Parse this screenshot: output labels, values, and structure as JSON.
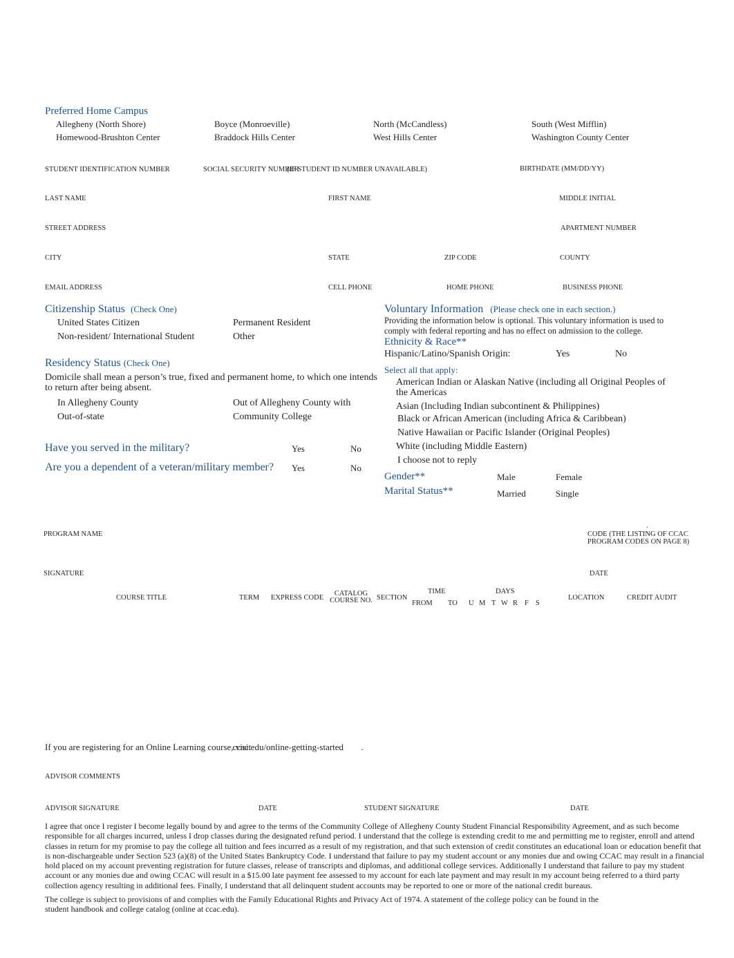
{
  "campus": {
    "title": "Preferred Home Campus",
    "options": [
      "Allegheny (North Shore)",
      "Boyce (Monroeville)",
      "North (McCandless)",
      "South (West Mifflin)",
      "Homewood-Brushton Center",
      "Braddock Hills Center",
      "West Hills Center",
      "Washington County Center"
    ]
  },
  "fields": {
    "student_id": "STUDENT IDENTIFICATION NUMBER",
    "ssn": "SOCIAL SECURITY NUMBER",
    "ssn_note": "(IF STUDENT ID NUMBER UNAVAILABLE)",
    "birthdate": "BIRTHDATE (MM/DD/YY)",
    "last_name": "LAST NAME",
    "first_name": "FIRST NAME",
    "middle_initial": "MIDDLE INITIAL",
    "street_address": "STREET ADDRESS",
    "apartment_number": "APARTMENT NUMBER",
    "city": "CITY",
    "state": "STATE",
    "zip_code": "ZIP CODE",
    "county": "COUNTY",
    "email_address": "EMAIL ADDRESS",
    "cell_phone": "CELL PHONE",
    "home_phone": "HOME PHONE",
    "business_phone": "BUSINESS PHONE"
  },
  "citizenship": {
    "title": "Citizenship Status",
    "note": "(Check One)",
    "options": [
      "United States Citizen",
      "Permanent Resident",
      "Non-resident/ International Student",
      "Other"
    ]
  },
  "residency": {
    "title": "Residency Status",
    "note": "(Check One)",
    "description": "Domicile shall mean a person’s true, fixed and permanent home, to which one intends to return after being absent.",
    "options": [
      "In Allegheny County",
      "Out of Allegheny County with",
      "Out-of-state",
      "Community College"
    ]
  },
  "military": {
    "served_question": "Have you served in the military?",
    "dependent_question": "Are you a dependent of a veteran/military member?",
    "yes": "Yes",
    "no": "No"
  },
  "voluntary": {
    "title": "Voluntary Information",
    "note": "(Please check one in each section.)",
    "description": "Providing the information below is optional. This voluntary information is used to comply with federal reporting and has no effect on admission to the college.",
    "ethnicity_title": "Ethnicity & Race**",
    "hispanic_label": "Hispanic/Latino/Spanish Origin:",
    "yes": "Yes",
    "no": "No",
    "select_all": "Select all that apply:",
    "races": [
      "American Indian or Alaskan Native (including all Original Peoples of the Americas",
      "Asian (Including Indian subcontinent & Philippines)",
      "Black or African American (including Africa & Caribbean)",
      "Native Hawaiian or Pacific Islander (Original Peoples)",
      "White (including Middle Eastern)",
      "I choose not to reply"
    ],
    "gender_title": "Gender**",
    "gender_options": [
      "Male",
      "Female"
    ],
    "marital_title": "Marital Status**",
    "marital_options": [
      "Married",
      "Single"
    ]
  },
  "program": {
    "program_name": "PROGRAM NAME",
    "code_label": "CODE (THE LISTING OF CCAC PROGRAM CODES ON PAGE 8)",
    "signature": "SIGNATURE",
    "date": "DATE"
  },
  "course_table": {
    "headers": {
      "course_title": "COURSE TITLE",
      "term": "TERM",
      "express_code": "EXPRESS CODE",
      "catalog_line1": "CATALOG",
      "catalog_line2": "COURSE NO.",
      "section": "SECTION",
      "time": "TIME",
      "from": "FROM",
      "to": "TO",
      "days": "DAYS",
      "day_letters": [
        "U",
        "M",
        "T",
        "W",
        "R",
        "F",
        "S"
      ],
      "location": "LOCATION",
      "credit_audit": "CREDIT AUDIT"
    },
    "rows": []
  },
  "online": {
    "text": "If you are registering for an Online Learning course, visit",
    "link": "ccac.edu/online-getting-started",
    "period": "."
  },
  "advisor": {
    "comments": "ADVISOR COMMENTS",
    "advisor_signature": "ADVISOR SIGNATURE",
    "date1": "DATE",
    "student_signature": "STUDENT SIGNATURE",
    "date2": "DATE"
  },
  "legal": {
    "agreement": "I agree that once I register I become legally bound by and agree to the terms of the Community College of Allegheny County Student Financial Responsibility Agreement, and as such become responsible for all charges incurred, unless I drop classes during the designated refund period. I understand that the college is extending credit to me and permitting me to register, enroll and attend classes in return for my promise to pay the college all tuition and fees incurred as a result of my registration, and that such extension of credit constitutes an educational loan or education benefit that is non-dischargeable under Section 523 (a)(8) of the United States Bankruptcy Code. I understand that failure to pay my student account or any monies due and owing CCAC may result in a financial hold placed on my account preventing registration for future classes, release of transcripts and diplomas, and additional college services. Additionally I understand that failure to pay my student account or any monies due and owing CCAC will result in a $15.00 late payment fee assessed to my account for each late payment and may result in my account being referred to a third party collection agency resulting in additional fees. Finally, I understand that all delinquent student accounts may be reported to one or more of the national credit bureaus.",
    "ferpa": "The college is subject to provisions of and complies with the Family Educational Rights and Privacy Act of 1974. A statement of the college policy can be found in the student handbook and college catalog (online at ccac.edu)."
  }
}
